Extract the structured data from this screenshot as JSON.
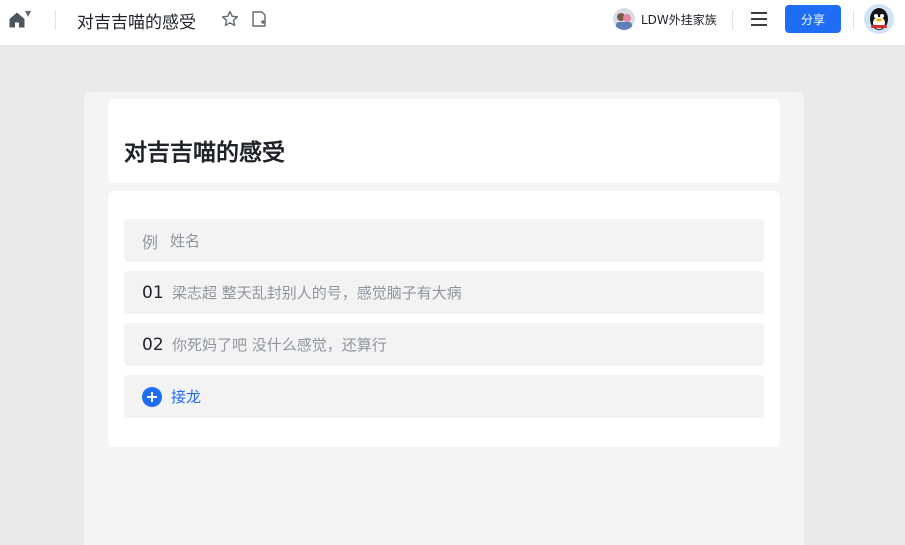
{
  "header": {
    "home_icon": "home-icon",
    "doc_title": "对吉吉喵的感受",
    "star_icon": "star-icon",
    "note_icon": "note-add-icon",
    "group_name": "LDW外挂家族",
    "menu_icon": "hamburger-menu-icon",
    "share_label": "分享"
  },
  "colors": {
    "accent": "#1f6df5",
    "page_bg": "#e9eaec",
    "row_bg": "#f3f3f4"
  },
  "card": {
    "title": "对吉吉喵的感受"
  },
  "list": {
    "example": {
      "label": "例",
      "text": "姓名"
    },
    "entries": [
      {
        "num": "01",
        "text": "梁志超  整天乱封别人的号，感觉脑子有大病"
      },
      {
        "num": "02",
        "text": "你死妈了吧 没什么感觉，还算行"
      }
    ],
    "add_label": "接龙"
  }
}
